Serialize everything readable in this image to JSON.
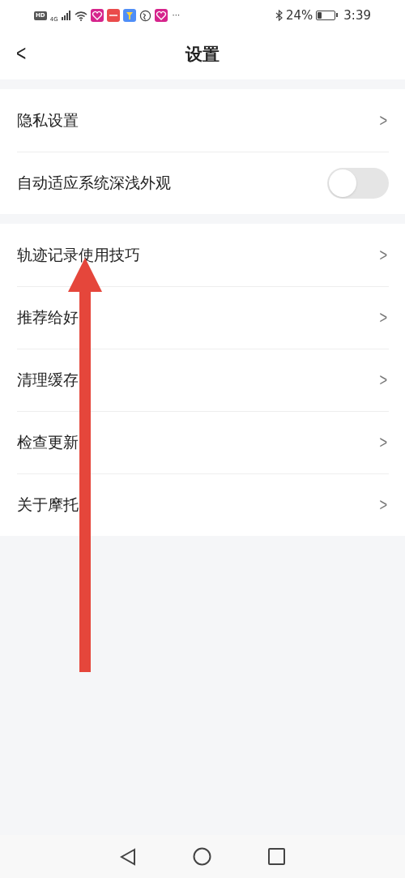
{
  "status_bar": {
    "hd": "HD",
    "network": "4G",
    "more": "···",
    "battery_percent": "24%",
    "time": "3:39"
  },
  "header": {
    "back": "<",
    "title": "设置"
  },
  "sections": [
    {
      "items": [
        {
          "kind": "link",
          "label": "隐私设置",
          "chevron": ">"
        },
        {
          "kind": "toggle",
          "label": "自动适应系统深浅外观",
          "on": false
        }
      ]
    },
    {
      "items": [
        {
          "kind": "link",
          "label": "轨迹记录使用技巧",
          "chevron": ">"
        },
        {
          "kind": "link",
          "label": "推荐给好",
          "chevron": ">"
        },
        {
          "kind": "link",
          "label": "清理缓存",
          "chevron": ">"
        },
        {
          "kind": "link",
          "label": "检查更新",
          "chevron": ">"
        },
        {
          "kind": "link",
          "label": "关于摩托",
          "chevron": ">"
        }
      ]
    }
  ],
  "annotation": {
    "kind": "arrow",
    "color": "#e5463b"
  }
}
